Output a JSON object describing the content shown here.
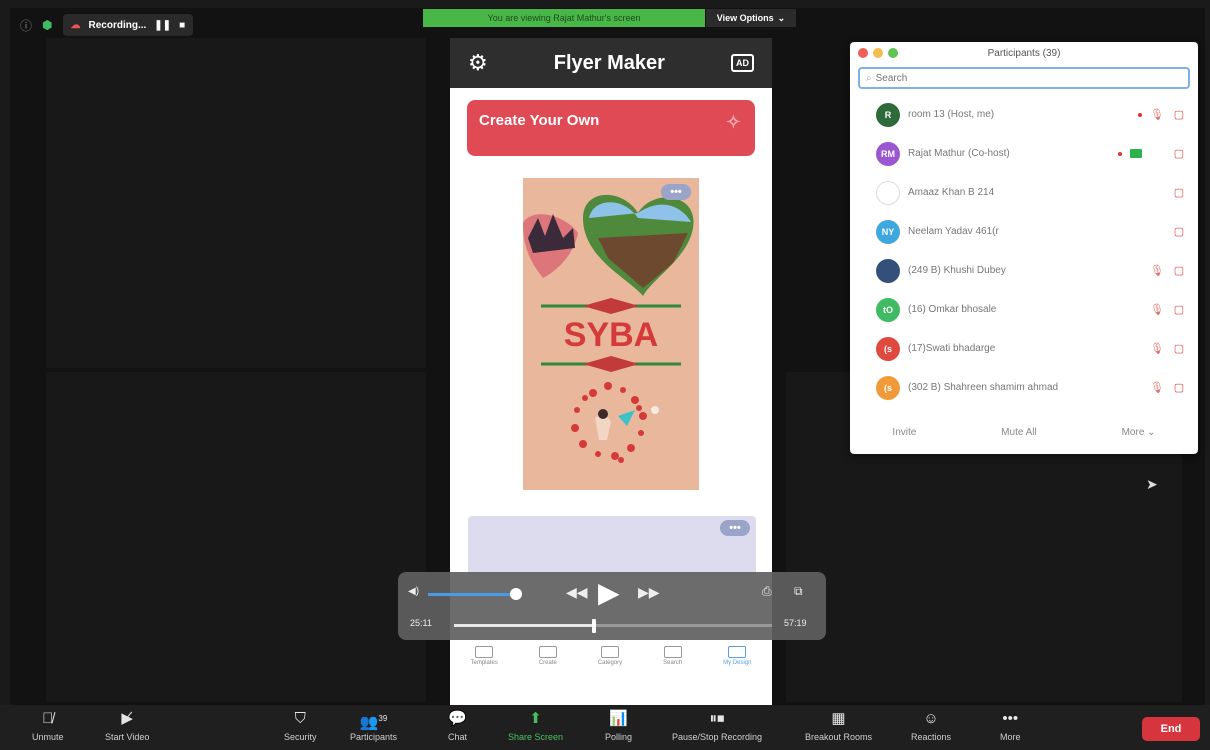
{
  "status_bar": {
    "recording_label": "Recording...",
    "share_banner": "You are viewing Rajat Mathur's screen",
    "view_options": "View Options"
  },
  "phone": {
    "title": "Flyer Maker",
    "create_label": "Create Your Own",
    "flyer_text": "SYBA",
    "more_dots": "•••",
    "tabs": [
      {
        "label": "Templates"
      },
      {
        "label": "Create"
      },
      {
        "label": "Category"
      },
      {
        "label": "Search"
      },
      {
        "label": "My Design"
      }
    ]
  },
  "player": {
    "elapsed": "25:11",
    "remaining": "57:19",
    "volume_fraction": 1.0,
    "progress_fraction": 0.44
  },
  "participants": {
    "title": "Participants (39)",
    "search_placeholder": "Search",
    "list": [
      {
        "initials": "R",
        "name": "room 13 (Host, me)",
        "color": "#2e6b3a",
        "recording_dot": true,
        "mic_muted": true,
        "cam_muted": true,
        "sharing": false
      },
      {
        "initials": "RM",
        "name": "Rajat Mathur (Co-host)",
        "color": "#9a57d1",
        "recording_dot": true,
        "mic_muted": false,
        "cam_muted": true,
        "sharing": true
      },
      {
        "initials": "",
        "name": "Amaaz Khan B 214",
        "color": "#ffffff",
        "recording_dot": false,
        "mic_muted": false,
        "cam_muted": true,
        "sharing": false
      },
      {
        "initials": "NY",
        "name": "Neelam Yadav 461(r",
        "color": "#3fa7e0",
        "recording_dot": false,
        "mic_muted": false,
        "cam_muted": true,
        "sharing": false
      },
      {
        "initials": "",
        "name": "(249 B) Khushi Dubey",
        "color": "#34507a",
        "recording_dot": false,
        "mic_muted": true,
        "cam_muted": true,
        "sharing": false
      },
      {
        "initials": "tO",
        "name": "(16) Omkar bhosale",
        "color": "#3fbb63",
        "recording_dot": false,
        "mic_muted": true,
        "cam_muted": true,
        "sharing": false
      },
      {
        "initials": "(s",
        "name": "(17)Swati bhadarge",
        "color": "#e0493e",
        "recording_dot": false,
        "mic_muted": true,
        "cam_muted": true,
        "sharing": false
      },
      {
        "initials": "(s",
        "name": "(302 B) Shahreen shamim ahmad",
        "color": "#f29a3a",
        "recording_dot": false,
        "mic_muted": true,
        "cam_muted": true,
        "sharing": false
      }
    ],
    "footer": {
      "invite": "Invite",
      "mute_all": "Mute All",
      "more": "More ⌄"
    }
  },
  "toolbar": {
    "unmute": "Unmute",
    "start_video": "Start Video",
    "security": "Security",
    "participants": "Participants",
    "participants_count": "39",
    "chat": "Chat",
    "share_screen": "Share Screen",
    "polling": "Polling",
    "pause_recording": "Pause/Stop Recording",
    "breakout_rooms": "Breakout Rooms",
    "reactions": "Reactions",
    "more": "More",
    "end": "End"
  },
  "colors": {
    "share_green": "#49b748",
    "end_red": "#d6353e",
    "create_red": "#e04a55",
    "search_focus": "#7fb1e8"
  }
}
